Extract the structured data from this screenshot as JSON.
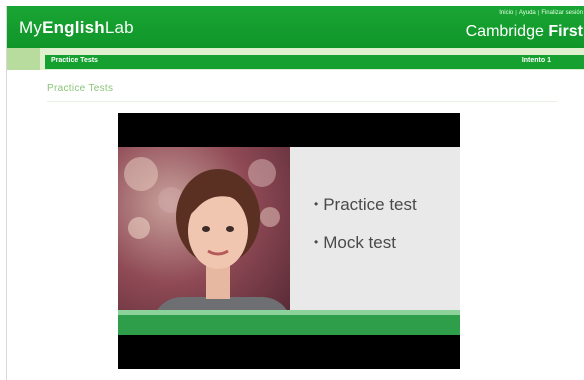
{
  "header": {
    "brand_pre": "My",
    "brand_bold": "English",
    "brand_post": "Lab",
    "links": [
      "Inicio",
      "Ayuda",
      "Finalizar sesión"
    ],
    "exam_light": "Cambridge",
    "exam_bold": "First"
  },
  "navbar": {
    "title": "Practice Tests",
    "attempts": "Intento 1"
  },
  "page": {
    "heading": "Practice Tests"
  },
  "video": {
    "bullets": [
      "Practice test",
      "Mock test"
    ],
    "colors": {
      "brand_green": "#15a030",
      "slide_accent": "#2f9e4a"
    }
  }
}
